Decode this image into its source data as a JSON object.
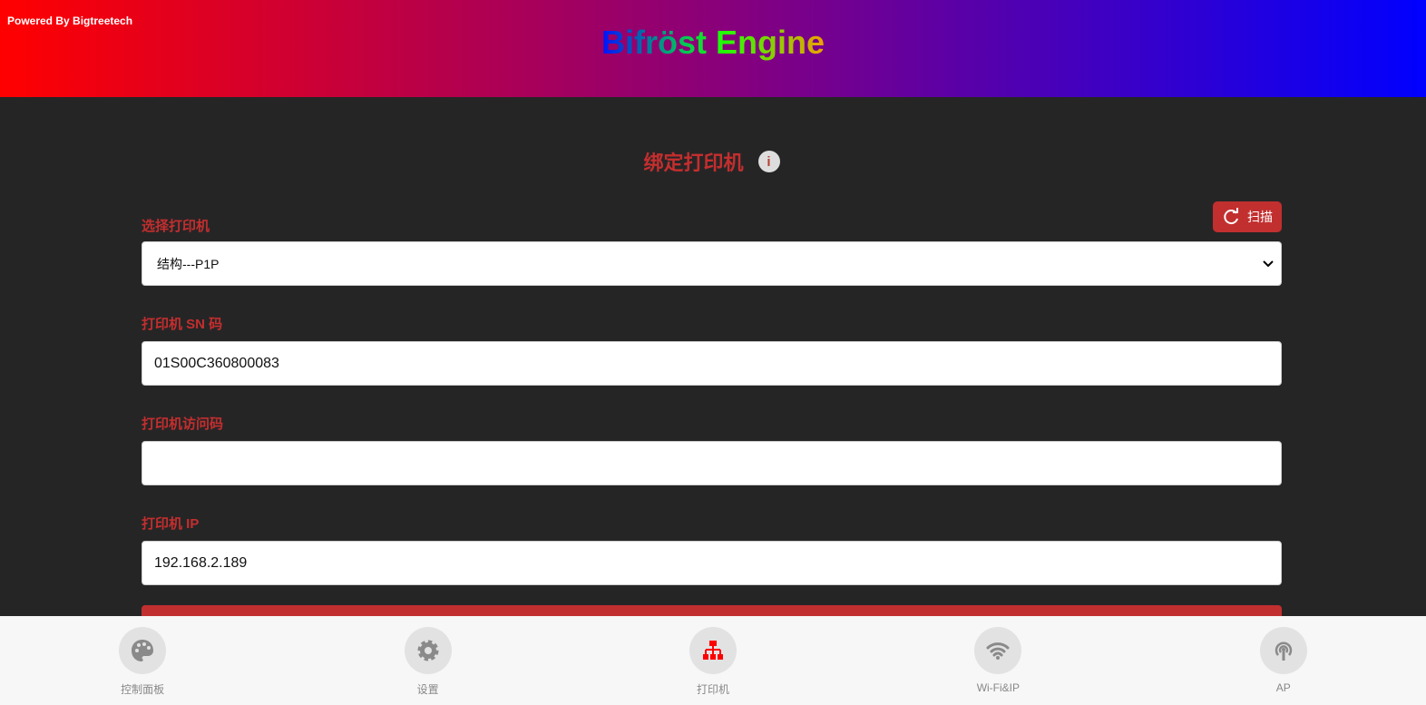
{
  "header": {
    "powered_by": "Powered By Bigtreetech",
    "brand": "Bifröst Engine"
  },
  "page": {
    "title": "绑定打印机",
    "info_icon": "i"
  },
  "form": {
    "select_label": "选择打印机",
    "scan_label": "扫描",
    "selected_printer": "结构---P1P",
    "sn_label": "打印机 SN 码",
    "sn_value": "01S00C360800083",
    "access_label": "打印机访问码",
    "access_value": "",
    "ip_label": "打印机 IP",
    "ip_value": "192.168.2.189"
  },
  "nav": [
    {
      "label": "控制面板"
    },
    {
      "label": "设置"
    },
    {
      "label": "打印机"
    },
    {
      "label": "Wi-Fi&IP"
    },
    {
      "label": "AP"
    }
  ],
  "colors": {
    "accent": "#c22f2f",
    "active_icon": "#ff0000"
  }
}
